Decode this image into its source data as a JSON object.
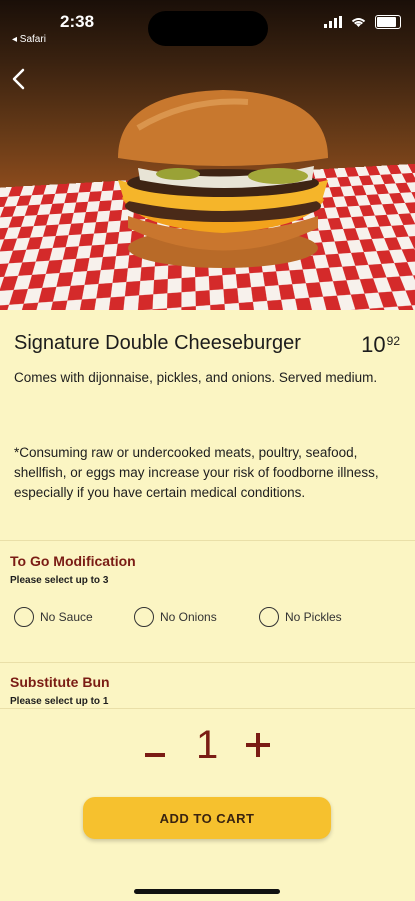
{
  "status_bar": {
    "time": "2:38",
    "back_app": "◂ Safari"
  },
  "item": {
    "name": "Signature Double Cheeseburger",
    "price_whole": "10",
    "price_cents": "92",
    "description": "Comes with dijonnaise, pickles, and onions. Served medium.",
    "warning": "*Consuming raw or undercooked meats, poultry, seafood, shellfish, or eggs may increase your risk of foodborne illness, especially if you have certain medical conditions."
  },
  "sections": [
    {
      "title": "To Go Modification",
      "subtitle": "Please select up to 3",
      "options": [
        "No Sauce",
        "No Onions",
        "No Pickles"
      ]
    },
    {
      "title": "Substitute Bun",
      "subtitle": "Please select up to 1"
    }
  ],
  "quantity": "1",
  "add_to_cart_label": "ADD TO CART",
  "colors": {
    "background": "#fbf5c3",
    "accent": "#7a1c14",
    "button": "#f6c12e"
  }
}
